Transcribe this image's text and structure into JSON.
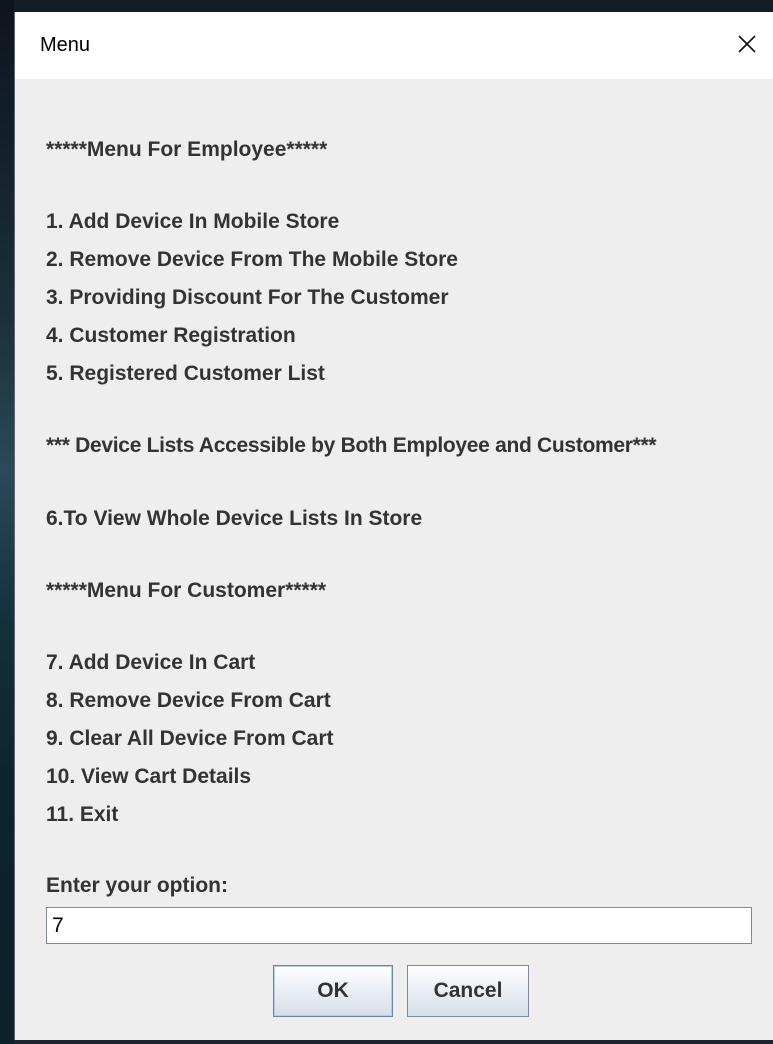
{
  "window": {
    "title": "Menu",
    "close_icon": "close-icon"
  },
  "menu": {
    "employee_header": "*****Menu For Employee*****",
    "employee_items": [
      "1. Add Device In Mobile Store",
      "2. Remove Device From The Mobile Store",
      "3. Providing Discount For The Customer",
      "4. Customer Registration",
      "5. Registered Customer List"
    ],
    "shared_header": "*** Device Lists Accessible by Both Employee and Customer***",
    "shared_items": [
      "6.To View Whole Device Lists In Store"
    ],
    "customer_header": "*****Menu For Customer*****",
    "customer_items": [
      "7. Add Device In Cart",
      "8. Remove Device From Cart",
      "9. Clear All Device From Cart",
      "10. View Cart Details",
      "11. Exit"
    ]
  },
  "prompt": {
    "label": "Enter your option:",
    "value": "7"
  },
  "buttons": {
    "ok_label": "OK",
    "cancel_label": "Cancel"
  }
}
